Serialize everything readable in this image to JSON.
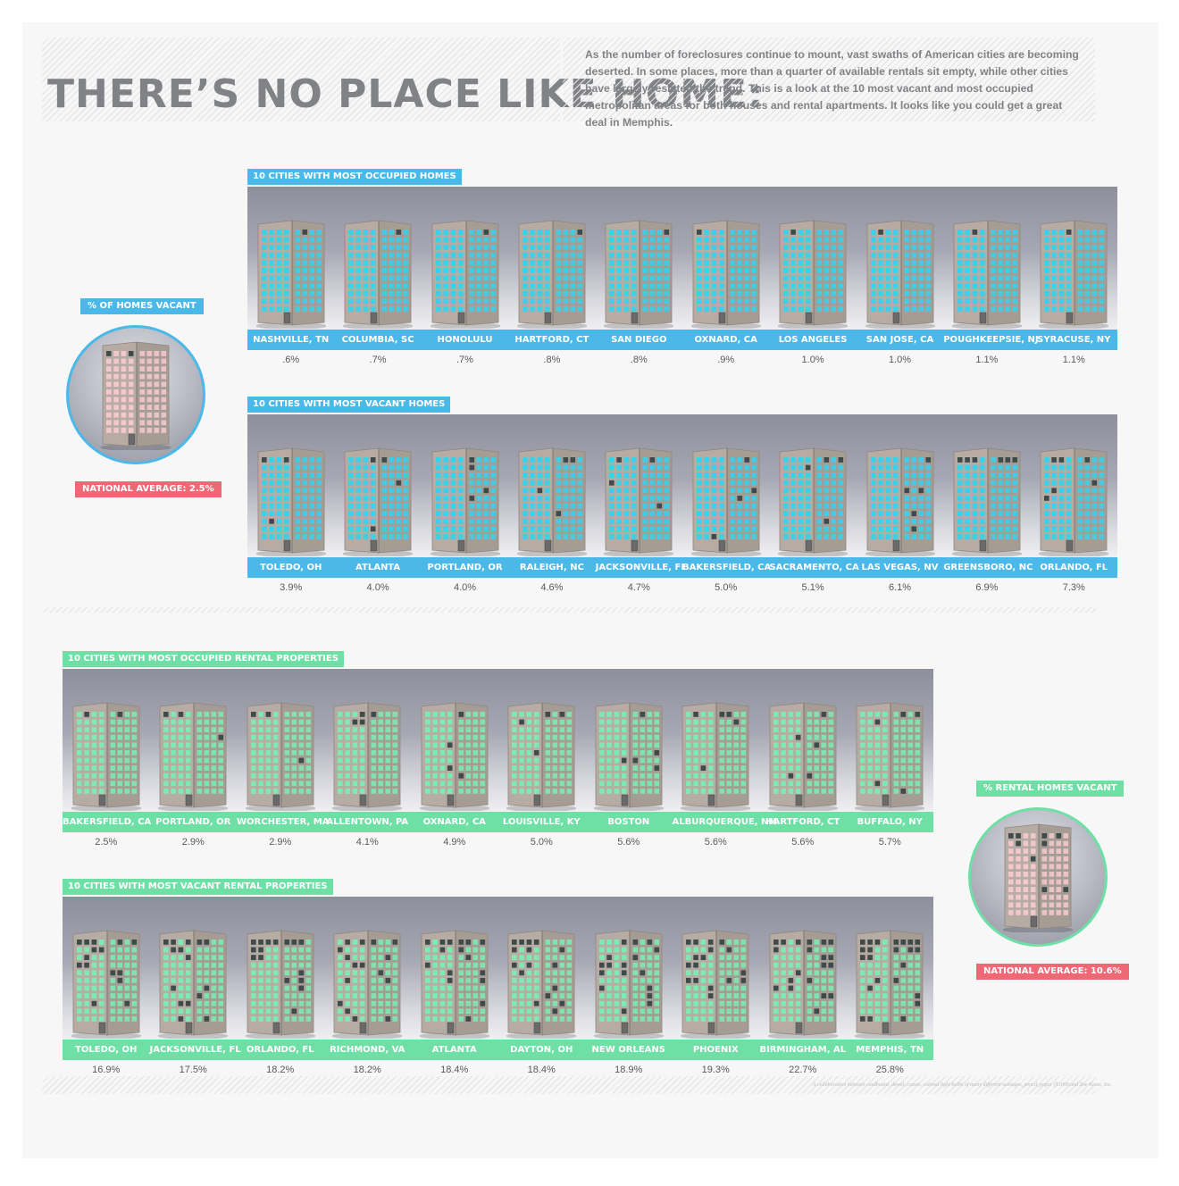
{
  "title": "THERE’S NO PLACE LIKE HOME:",
  "intro": "As the number of foreclosures continue to mount, vast swaths of American cities are becoming deserted. In some places, more than a quarter of available rentals sit empty, while other cities have largely resisted the trend. This is a look at the 10 most vacant and most occupied metropolitan areas for both houses and rental apartments. It looks like you could get a great deal in Memphis.",
  "colors": {
    "blue": "#4bb8ea",
    "green": "#6ee0a6",
    "red": "#ef6875",
    "window_blue": "#33d4ee",
    "window_green": "#7aedb4",
    "window_pink": "#f7c9cf"
  },
  "homes_side": {
    "label": "% OF HOMES VACANT",
    "average": "NATIONAL AVERAGE: 2.5%",
    "vacant_fraction": 0.025
  },
  "rentals_side": {
    "label": "% RENTAL HOMES VACANT",
    "average": "NATIONAL AVERAGE: 10.6%",
    "vacant_fraction": 0.106
  },
  "panels": [
    {
      "title": "10 CITIES WITH MOST OCCUPIED HOMES",
      "theme": "blue",
      "cities": [
        "NASHVILLE, TN",
        "COLUMBIA, SC",
        "HONOLULU",
        "HARTFORD, CT",
        "SAN DIEGO",
        "OXNARD, CA",
        "LOS ANGELES",
        "SAN JOSE, CA",
        "POUGHKEEPSIE, NJ",
        "SYRACUSE, NY"
      ],
      "values": [
        ".6%",
        ".7%",
        ".7%",
        ".8%",
        ".8%",
        ".9%",
        "1.0%",
        "1.0%",
        "1.1%",
        "1.1%"
      ],
      "percents": [
        0.6,
        0.7,
        0.7,
        0.8,
        0.8,
        0.9,
        1.0,
        1.0,
        1.1,
        1.1
      ]
    },
    {
      "title": "10 CITIES WITH MOST VACANT HOMES",
      "theme": "blue",
      "cities": [
        "TOLEDO, OH",
        "ATLANTA",
        "PORTLAND, OR",
        "RALEIGH, NC",
        "JACKSONVILLE, FL",
        "BAKERSFIELD, CA",
        "SACRAMENTO, CA",
        "LAS VEGAS, NV",
        "GREENSBORO, NC",
        "ORLANDO, FL"
      ],
      "values": [
        "3.9%",
        "4.0%",
        "4.0%",
        "4.6%",
        "4.7%",
        "5.0%",
        "5.1%",
        "6.1%",
        "6.9%",
        "7.3%"
      ],
      "percents": [
        3.9,
        4.0,
        4.0,
        4.6,
        4.7,
        5.0,
        5.1,
        6.1,
        6.9,
        7.3
      ]
    },
    {
      "title": "10 CITIES WITH MOST OCCUPIED RENTAL PROPERTIES",
      "theme": "green",
      "cities": [
        "BAKERSFIELD, CA",
        "PORTLAND, OR",
        "WORCHESTER, MA",
        "ALLENTOWN, PA",
        "OXNARD, CA",
        "LOUISVILLE, KY",
        "BOSTON",
        "ALBURQUERQUE, NM",
        "HARTFORD, CT",
        "BUFFALO, NY"
      ],
      "values": [
        "2.5%",
        "2.9%",
        "2.9%",
        "4.1%",
        "4.9%",
        "5.0%",
        "5.6%",
        "5.6%",
        "5.6%",
        "5.7%"
      ],
      "percents": [
        2.5,
        2.9,
        2.9,
        4.1,
        4.9,
        5.0,
        5.6,
        5.6,
        5.6,
        5.7
      ]
    },
    {
      "title": "10 CITIES WITH MOST VACANT RENTAL PROPERTIES",
      "theme": "green",
      "cities": [
        "TOLEDO, OH",
        "JACKSONVILLE, FL",
        "ORLANDO, FL",
        "RICHMOND, VA",
        "ATLANTA",
        "DAYTON, OH",
        "NEW ORLEANS",
        "PHOENIX",
        "BIRMINGHAM, AL",
        "MEMPHIS, TN"
      ],
      "values": [
        "16.9%",
        "17.5%",
        "18.2%",
        "18.2%",
        "18.4%",
        "18.4%",
        "18.9%",
        "19.3%",
        "22.7%",
        "25.8%"
      ],
      "percents": [
        16.9,
        17.5,
        18.2,
        18.2,
        18.4,
        18.4,
        18.9,
        19.3,
        22.7,
        25.8
      ]
    }
  ],
  "credit": "A collaboration between cardboard, dowel, coasts, colored light bulbs of many different wattages, pencil, paper ($1000 and Zoe Keats, Inc."
}
